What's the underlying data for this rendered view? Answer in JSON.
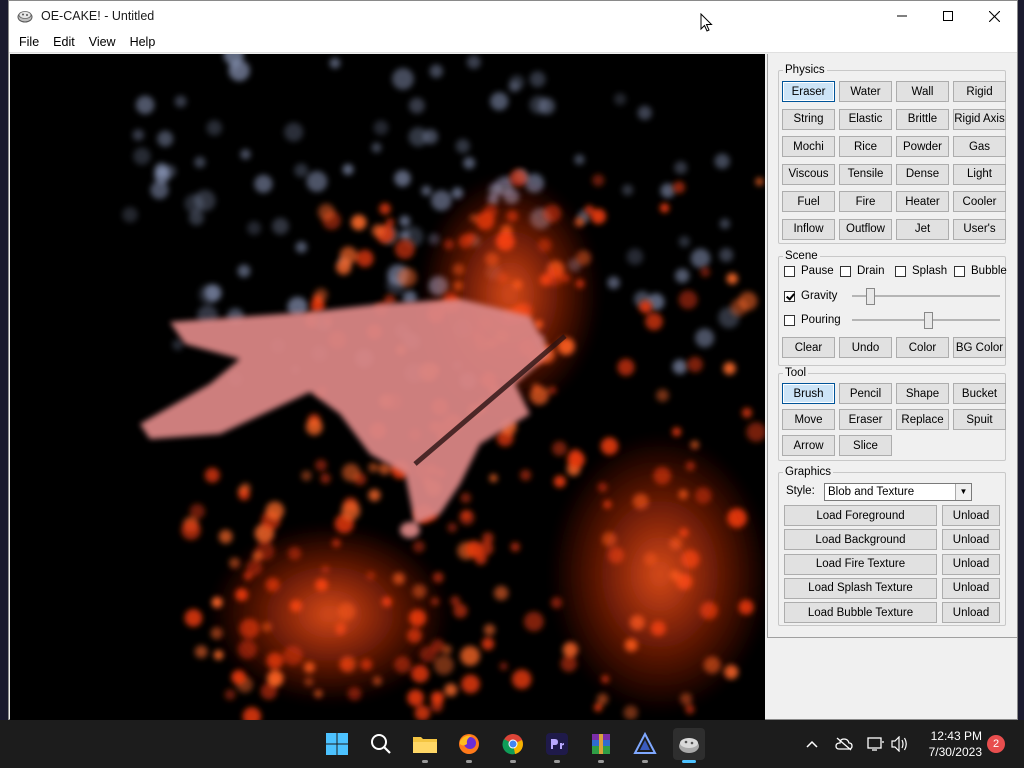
{
  "window": {
    "title": "OE-CAKE! - Untitled"
  },
  "menu": [
    "File",
    "Edit",
    "View",
    "Help"
  ],
  "physics": {
    "legend": "Physics",
    "buttons": [
      "Eraser",
      "Water",
      "Wall",
      "Rigid",
      "String",
      "Elastic",
      "Brittle",
      "Rigid Axis",
      "Mochi",
      "Rice",
      "Powder",
      "Gas",
      "Viscous",
      "Tensile",
      "Dense",
      "Light",
      "Fuel",
      "Fire",
      "Heater",
      "Cooler",
      "Inflow",
      "Outflow",
      "Jet",
      "User's"
    ],
    "selected": "Eraser"
  },
  "scene": {
    "legend": "Scene",
    "checkboxes": [
      {
        "label": "Pause",
        "checked": false
      },
      {
        "label": "Drain",
        "checked": false
      },
      {
        "label": "Splash",
        "checked": false
      },
      {
        "label": "Bubble",
        "checked": false
      }
    ],
    "gravity": {
      "label": "Gravity",
      "checked": true,
      "value": 0.1
    },
    "pouring": {
      "label": "Pouring",
      "checked": false,
      "value": 0.52
    },
    "buttons": [
      "Clear",
      "Undo",
      "Color",
      "BG Color"
    ]
  },
  "tool": {
    "legend": "Tool",
    "buttons": [
      "Brush",
      "Pencil",
      "Shape",
      "Bucket",
      "Move",
      "Eraser",
      "Replace",
      "Spuit",
      "Arrow",
      "Slice"
    ],
    "selected": "Brush"
  },
  "graphics": {
    "legend": "Graphics",
    "style_label": "Style:",
    "style_value": "Blob and Texture",
    "loads": [
      "Load Foreground",
      "Load Background",
      "Load Fire Texture",
      "Load Splash Texture",
      "Load Bubble Texture"
    ],
    "unload_label": "Unload"
  },
  "taskbar": {
    "time": "12:43 PM",
    "date": "7/30/2023",
    "notifications": "2"
  },
  "colors": {
    "accent": "#4cc2ff",
    "fire": "#ff4a1c",
    "pink": "#e88a8a"
  }
}
